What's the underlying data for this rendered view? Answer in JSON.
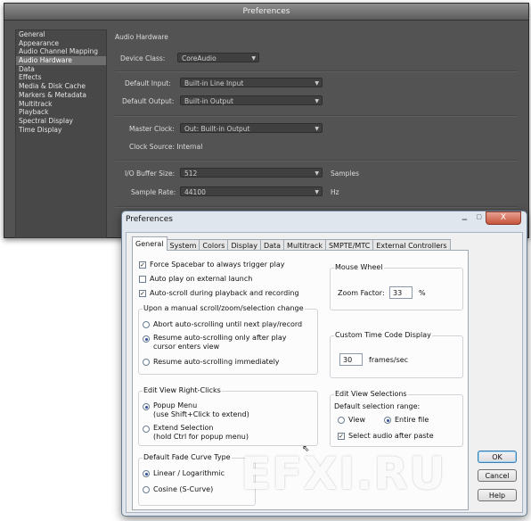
{
  "dark": {
    "title": "Preferences",
    "sidebar": [
      "General",
      "Appearance",
      "Audio Channel Mapping",
      "Audio Hardware",
      "Data",
      "Effects",
      "Media & Disk Cache",
      "Markers & Metadata",
      "Multitrack",
      "Playback",
      "Spectral Display",
      "Time Display"
    ],
    "selected": "Audio Hardware",
    "section_title": "Audio Hardware",
    "device_class_label": "Device Class:",
    "device_class_value": "CoreAudio",
    "default_input_label": "Default Input:",
    "default_input_value": "Built-in Line Input",
    "default_output_label": "Default Output:",
    "default_output_value": "Built-in Output",
    "master_clock_label": "Master Clock:",
    "master_clock_value": "Out: Built-in Output",
    "clock_source_text": "Clock Source: Internal",
    "buffer_label": "I/O Buffer Size:",
    "buffer_value": "512",
    "buffer_unit": "Samples",
    "rate_label": "Sample Rate:",
    "rate_value": "44100",
    "rate_unit": "Hz"
  },
  "light": {
    "title": "Preferences",
    "close": "X",
    "tabs": [
      "General",
      "System",
      "Colors",
      "Display",
      "Data",
      "Multitrack",
      "SMPTE/MTC",
      "External Controllers"
    ],
    "active_tab": "General",
    "force_spacebar": "Force Spacebar to always trigger play",
    "auto_play": "Auto play on external launch",
    "auto_scroll": "Auto-scroll during playback and recording",
    "scroll_group_title": "Upon a manual scroll/zoom/selection change",
    "abort_scroll": "Abort auto-scrolling until next play/record",
    "resume_after_line1": "Resume auto-scrolling only after play",
    "resume_after_line2": "cursor enters view",
    "resume_now": "Resume auto-scrolling immediately",
    "right_click_title": "Edit View Right-Clicks",
    "popup_menu_line1": "Popup Menu",
    "popup_menu_line2": "(use Shift+Click to extend)",
    "extend_sel_line1": "Extend Selection",
    "extend_sel_line2": "(hold Ctrl for popup menu)",
    "fade_title": "Default Fade Curve Type",
    "fade_linear": "Linear / Logarithmic",
    "fade_cosine": "Cosine (S-Curve)",
    "mouse_wheel_title": "Mouse Wheel",
    "zoom_factor_label": "Zoom Factor:",
    "zoom_factor_value": "33",
    "zoom_factor_unit": "%",
    "time_code_title": "Custom Time Code Display",
    "frames_value": "30",
    "frames_unit": "frames/sec",
    "edit_sel_title": "Edit View Selections",
    "default_range_label": "Default selection range:",
    "range_view": "View",
    "range_entire": "Entire file",
    "select_audio": "Select audio after paste",
    "ok": "OK",
    "cancel": "Cancel",
    "help": "Help"
  },
  "watermark": "EFXI.RU"
}
